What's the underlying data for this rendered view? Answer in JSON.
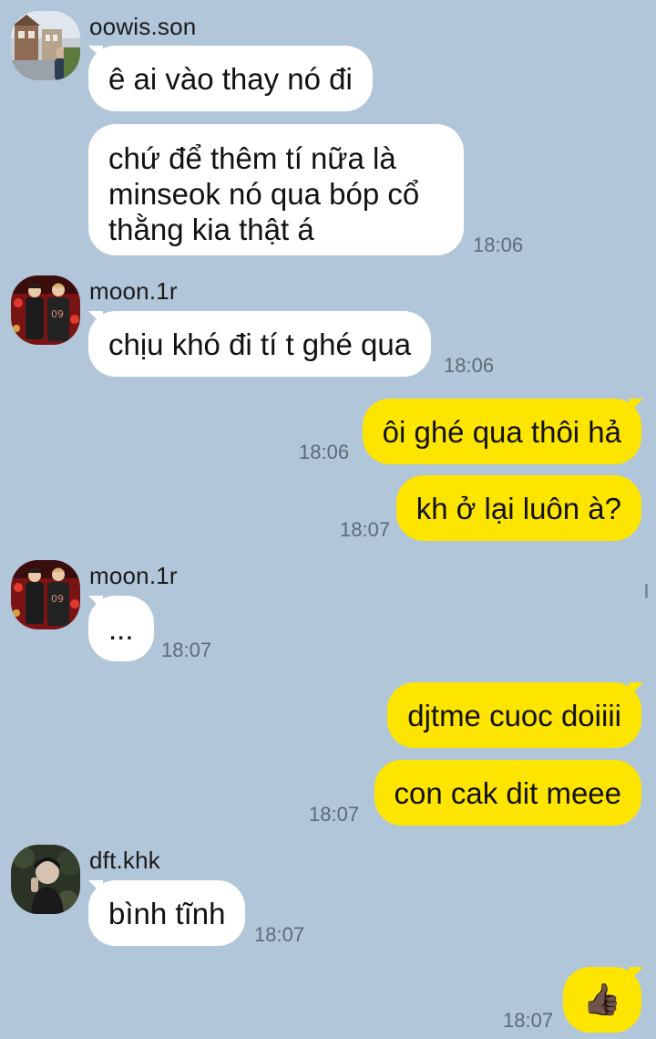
{
  "messages": [
    {
      "sender": "oowis.son",
      "text": "ê ai vào thay nó đi"
    },
    {
      "text": "chứ để thêm tí nữa là minseok nó qua bóp cổ thằng kia thật á",
      "time": "18:06"
    },
    {
      "sender": "moon.1r",
      "text": "chịu khó đi tí t ghé qua",
      "time": "18:06"
    },
    {
      "text": "ôi ghé qua thôi hả",
      "time": "18:06"
    },
    {
      "text": "kh ở lại luôn à?",
      "time": "18:07"
    },
    {
      "sender": "moon.1r",
      "text": "...",
      "time": "18:07"
    },
    {
      "text": "djtme cuoc doiiii"
    },
    {
      "text": "con cak dit meee",
      "time": "18:07"
    },
    {
      "sender": "dft.khk",
      "text": "bình tĩnh",
      "time": "18:07"
    },
    {
      "text": "👍🏿",
      "time": "18:07"
    }
  ],
  "colors": {
    "background": "#b1c6d9",
    "incoming_bubble": "#ffffff",
    "outgoing_bubble": "#fee500"
  },
  "icons": {
    "reaction": "thumbs-up-icon",
    "avatars": [
      "avatar-oowis-son",
      "avatar-moon-1r",
      "avatar-moon-1r",
      "avatar-dft-khk"
    ]
  }
}
